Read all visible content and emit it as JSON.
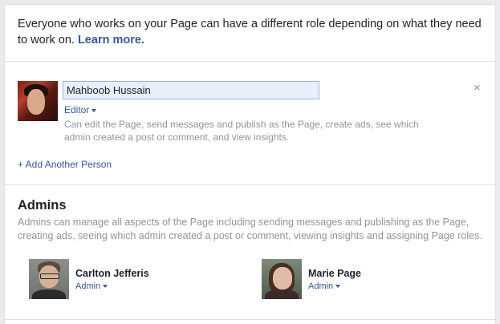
{
  "intro": {
    "text": "Everyone who works on your Page can have a different role depending on what they need to work on.",
    "learn_more": "Learn more."
  },
  "new_person": {
    "name_value": "Mahboob Hussain",
    "role": "Editor",
    "role_description": "Can edit the Page, send messages and publish as the Page, create ads, see which admin created a post or comment, and view insights.",
    "remove_glyph": "×",
    "avatar_icon": "user-photo"
  },
  "add_another": "+ Add Another Person",
  "admins": {
    "title": "Admins",
    "description": "Admins can manage all aspects of the Page including sending messages and publishing as the Page, creating ads, seeing which admin created a post or comment, viewing insights and assigning Page roles.",
    "people": [
      {
        "name": "Carlton Jefferis",
        "role": "Admin"
      },
      {
        "name": "Marie Page",
        "role": "Admin"
      }
    ]
  },
  "colors": {
    "link": "#365899",
    "text": "#1d2129",
    "muted": "#90949c",
    "input_bg": "#e8eefa",
    "input_border": "#9cb4d8"
  }
}
